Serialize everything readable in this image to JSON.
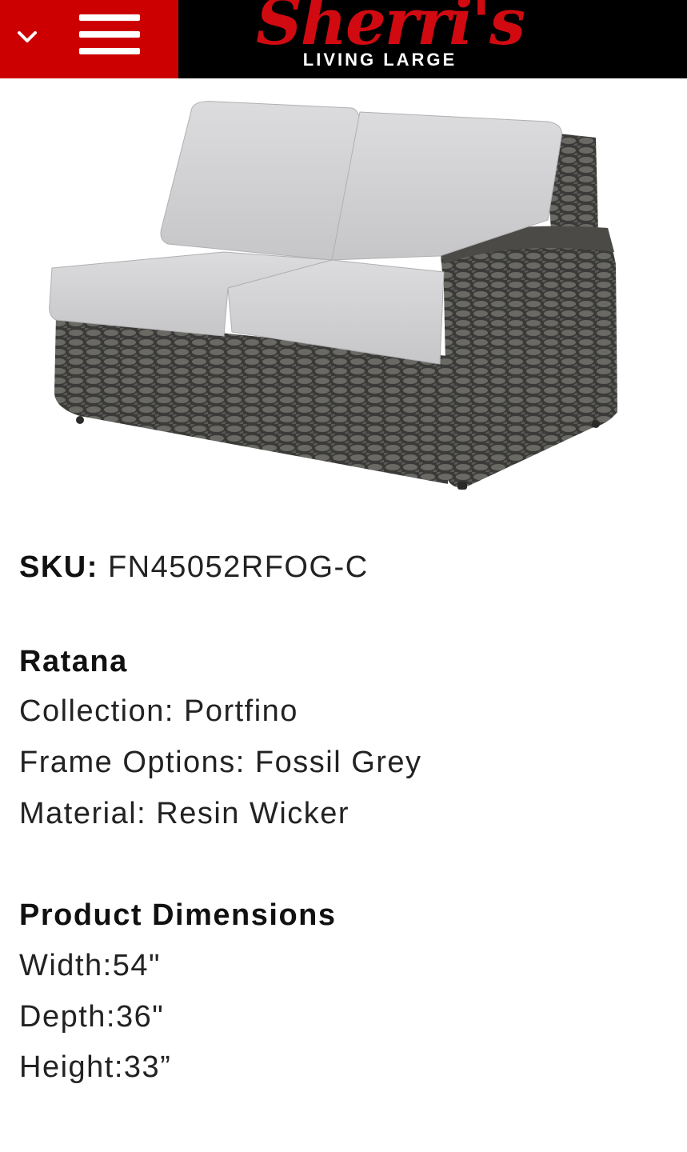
{
  "header": {
    "brand_name": "Sherri's",
    "brand_tagline": "LIVING LARGE",
    "dropdown_icon": "chevron-down-icon",
    "menu_icon": "hamburger-menu-icon",
    "colors": {
      "primary": "#cc0000",
      "bar": "#000000",
      "logo": "#d10a11"
    }
  },
  "product": {
    "image_alt": "Wicker loveseat with light grey cushions",
    "sku_label": "SKU:",
    "sku_value": "FN45052RFOG-C",
    "brand": "Ratana",
    "collection": "Collection: Portfino",
    "frame_options": "Frame Options: Fossil Grey",
    "material": "Material: Resin Wicker",
    "dimensions_heading": "Product Dimensions",
    "width": "Width:54\"",
    "depth": "Depth:36\"",
    "height": "Height:33”"
  }
}
